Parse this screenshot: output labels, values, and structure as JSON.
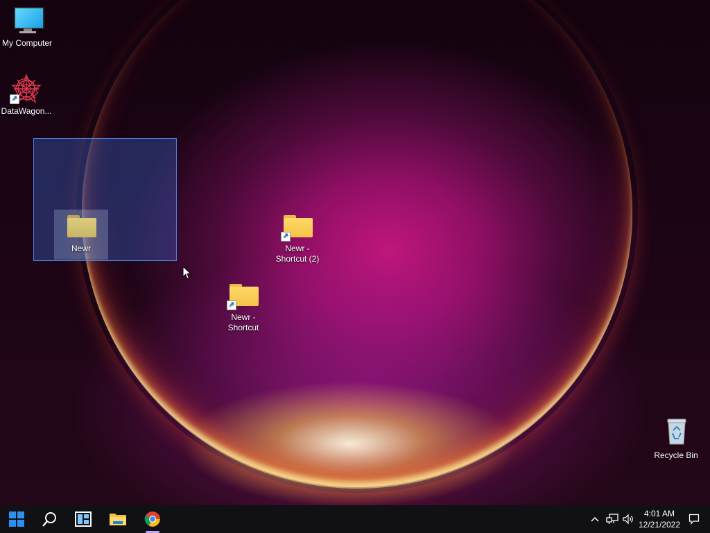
{
  "desktop": {
    "icons": [
      {
        "label": "My Computer",
        "icon": "monitor-icon"
      },
      {
        "label": "DataWagon...",
        "icon": "datawagon-app-icon",
        "shortcut": true
      },
      {
        "label": "Newr",
        "icon": "folder-icon",
        "selected": true
      },
      {
        "label": "Newr - Shortcut (2)",
        "icon": "folder-icon",
        "shortcut": true
      },
      {
        "label": "Newr - Shortcut",
        "icon": "folder-icon",
        "shortcut": true
      },
      {
        "label": "Recycle Bin",
        "icon": "recycle-bin-icon"
      }
    ]
  },
  "taskbar": {
    "buttons": [
      {
        "name": "start-button",
        "icon": "windows-logo-icon"
      },
      {
        "name": "search-button",
        "icon": "search-icon"
      },
      {
        "name": "widgets-button",
        "icon": "widgets-icon"
      },
      {
        "name": "file-explorer-button",
        "icon": "file-explorer-icon"
      },
      {
        "name": "chrome-button",
        "icon": "chrome-icon",
        "active": true
      }
    ],
    "tray": {
      "icons": [
        "chevron-up-icon",
        "network-icon",
        "volume-icon"
      ],
      "time": "4:01 AM",
      "date": "12/21/2022",
      "notification_icon": "notification-icon"
    }
  },
  "colors": {
    "selection_fill": "#3c6edc",
    "taskbar": "#101015",
    "accent": "#c3a2ff"
  }
}
